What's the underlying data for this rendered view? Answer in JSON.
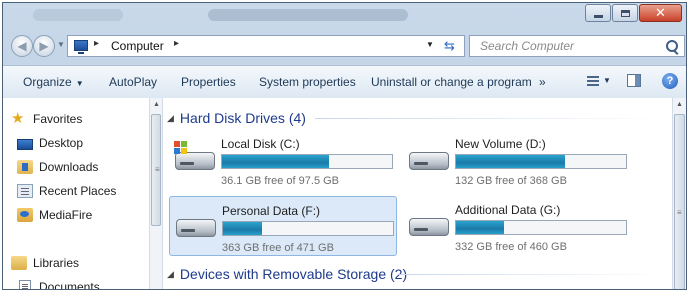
{
  "window": {
    "controls": {
      "minimize_icon": "minimize-icon",
      "maximize_icon": "maximize-icon",
      "close_icon": "close-icon",
      "close_glyph": "✕"
    }
  },
  "address": {
    "crumbs": [
      "Computer"
    ],
    "search_placeholder": "Search Computer"
  },
  "toolbar": {
    "organize": "Organize",
    "autoplay": "AutoPlay",
    "properties": "Properties",
    "system_properties": "System properties",
    "uninstall": "Uninstall or change a program",
    "more": "»",
    "help": "?"
  },
  "sidebar": {
    "items": [
      {
        "label": "Favorites",
        "icon": "star-icon"
      },
      {
        "label": "Desktop",
        "icon": "desktop-icon"
      },
      {
        "label": "Downloads",
        "icon": "downloads-folder-icon"
      },
      {
        "label": "Recent Places",
        "icon": "recent-places-icon"
      },
      {
        "label": "MediaFire",
        "icon": "mediafire-icon"
      },
      {
        "label": "Libraries",
        "icon": "libraries-icon"
      },
      {
        "label": "Documents",
        "icon": "documents-icon"
      }
    ]
  },
  "content": {
    "groups": [
      {
        "label": "Hard Disk Drives (4)"
      },
      {
        "label": "Devices with Removable Storage (2)"
      }
    ],
    "drives": [
      {
        "name": "Local Disk (C:)",
        "free_text": "36.1 GB free of 97.5 GB",
        "used_fraction": 0.63,
        "selected": false,
        "system": true
      },
      {
        "name": "New Volume (D:)",
        "free_text": "132 GB free of 368 GB",
        "used_fraction": 0.64,
        "selected": false,
        "system": false
      },
      {
        "name": "Personal Data (F:)",
        "free_text": "363 GB free of 471 GB",
        "used_fraction": 0.23,
        "selected": true,
        "system": false
      },
      {
        "name": "Additional Data (G:)",
        "free_text": "332 GB free of 460 GB",
        "used_fraction": 0.28,
        "selected": false,
        "system": false
      }
    ]
  },
  "colors": {
    "accent": "#1e3a8c",
    "bar_fill": "#1b7aa8",
    "selection": "#dbe9f9"
  }
}
